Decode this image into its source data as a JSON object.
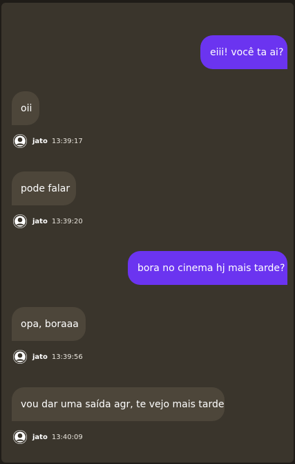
{
  "messages": [
    {
      "direction": "out",
      "text": "eiii! você ta ai?"
    },
    {
      "direction": "in",
      "text": "oii",
      "author": "jato",
      "time": "13:39:17"
    },
    {
      "direction": "in",
      "text": "pode falar",
      "author": "jato",
      "time": "13:39:20"
    },
    {
      "direction": "out",
      "text": "bora no cinema hj mais tarde?"
    },
    {
      "direction": "in",
      "text": "opa, boraaa",
      "author": "jato",
      "time": "13:39:56"
    },
    {
      "direction": "in",
      "text": "vou dar uma saída agr, te vejo mais tarde",
      "author": "jato",
      "time": "13:40:09"
    }
  ],
  "colors": {
    "outgoing_bubble": "#6b34f0",
    "incoming_bubble": "#4d463a",
    "panel": "#3a352c"
  },
  "icons": {
    "avatar": "user-avatar-icon"
  }
}
